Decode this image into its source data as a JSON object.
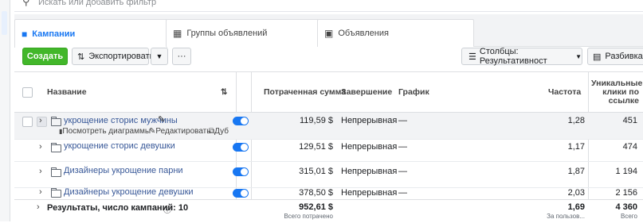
{
  "search": {
    "placeholder": "Искать или добавить фильтр"
  },
  "tabs": [
    {
      "label": "Кампании"
    },
    {
      "label": "Группы объявлений"
    },
    {
      "label": "Объявления"
    }
  ],
  "toolbar": {
    "create_label": "Создать",
    "export_label": "Экспортировать",
    "more_label": "···",
    "columns_label": "Столбцы: Результативност",
    "breakdown_label": "Разбивка"
  },
  "columns": {
    "name": "Название",
    "spent": "Потраченная сумма",
    "end": "Завершение",
    "schedule": "График",
    "frequency": "Частота",
    "unique_clicks": [
      "Уникальные",
      "клики по",
      "ссылке"
    ]
  },
  "rows": [
    {
      "name": "укрощение сторис мужчины",
      "spent": "119,59 $",
      "end": "Непрерывная",
      "schedule": "—",
      "frequency": "1,28",
      "clicks": "451",
      "actions": {
        "charts": "Посмотреть диаграммы",
        "edit": "Редактировать",
        "dup": "Дуб"
      }
    },
    {
      "name": "укрощение сторис девушки",
      "spent": "129,51 $",
      "end": "Непрерывная",
      "schedule": "—",
      "frequency": "1,17",
      "clicks": "474"
    },
    {
      "name": "Дизайнеры укрощение парни",
      "spent": "315,01 $",
      "end": "Непрерывная",
      "schedule": "—",
      "frequency": "1,87",
      "clicks": "1 194"
    },
    {
      "name": "Дизайнеры укрощение девушки",
      "spent": "378,50 $",
      "end": "Непрерывная",
      "schedule": "—",
      "frequency": "2,03",
      "clicks": "2 156"
    }
  ],
  "totals": {
    "label": "Результаты, число кампаний: 10",
    "spent": "952,61 $",
    "spent_sub": "Всего потрачено",
    "frequency": "1,69",
    "frequency_sub": "За пользов...",
    "clicks": "4 360",
    "clicks_sub": "Всего"
  },
  "colors": {
    "accent": "#1877f2",
    "create": "#42b72a",
    "link": "#385898"
  }
}
